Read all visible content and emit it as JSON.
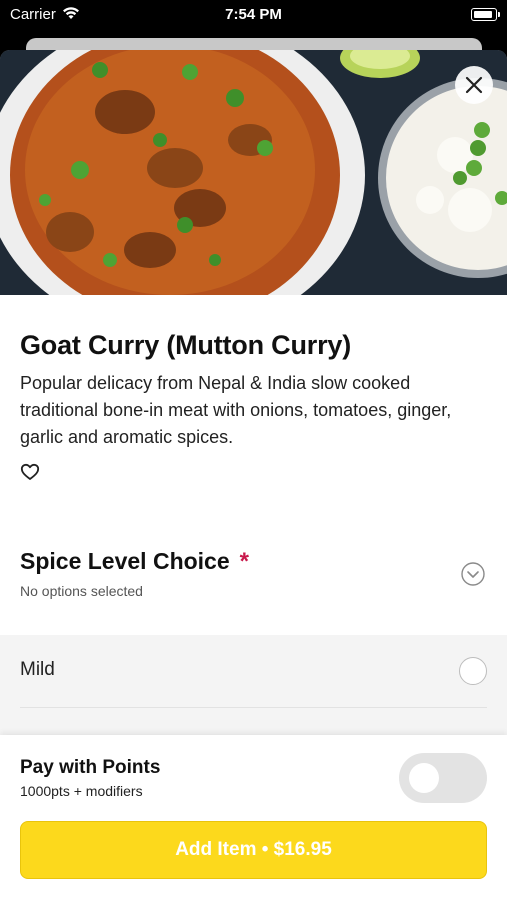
{
  "status_bar": {
    "carrier": "Carrier",
    "time": "7:54 PM",
    "wifi_icon": "wifi-icon",
    "battery_icon": "battery-icon"
  },
  "item": {
    "title": "Goat Curry (Mutton Curry)",
    "description": "Popular delicacy from Nepal & India slow cooked traditional bone-in meat with onions, tomatoes, ginger, garlic and aromatic spices.",
    "favorite_icon": "heart-outline-icon",
    "close_icon": "close-icon",
    "image": "goat-curry-photo"
  },
  "spice_section": {
    "title": "Spice Level Choice",
    "required_mark": "*",
    "subtitle": "No options selected",
    "expand_icon": "chevron-down-circle-icon",
    "options": [
      {
        "label": "Mild"
      }
    ]
  },
  "footer": {
    "pay_title": "Pay with Points",
    "pay_sub": "1000pts + modifiers",
    "pay_toggle_on": false,
    "add_button_label": "Add Item • $16.95"
  },
  "colors": {
    "accent_yellow": "#fcd91c",
    "required_red": "#c8184b",
    "option_bg": "#f4f4f4",
    "toggle_off": "#e3e3e3"
  }
}
